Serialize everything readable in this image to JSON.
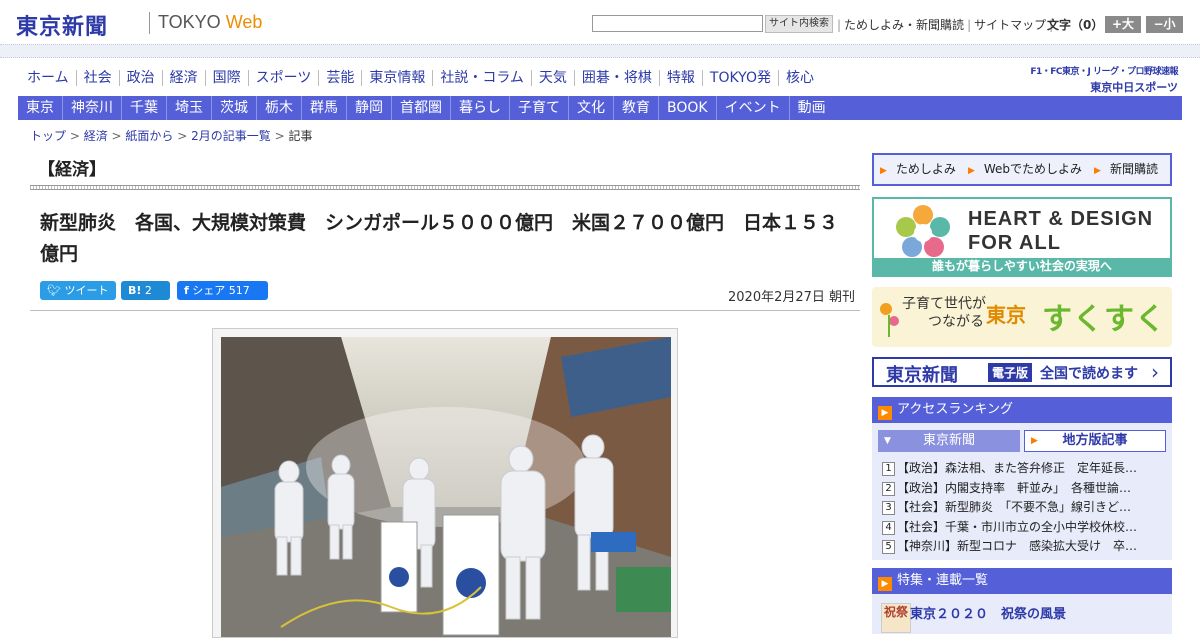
{
  "header": {
    "logo": "東京新聞",
    "tokyo": "TOKYO",
    "web": "Web",
    "search_button": "サイト内検索",
    "links": [
      "ためしよみ・新聞購読",
      "サイトマップ"
    ],
    "font_size_label": "文字（0）",
    "font_bigger": "+大",
    "font_smaller": "−小"
  },
  "nav": {
    "items": [
      "ホーム",
      "社会",
      "政治",
      "経済",
      "国際",
      "スポーツ",
      "芸能",
      "東京情報",
      "社説・コラム",
      "天気",
      "囲碁・将棋",
      "特報",
      "TOKYO発",
      "核心"
    ],
    "sports_line1": "F1・FC東京・J リーグ・プロ野球速報",
    "sports_line2": "東京中日スポーツ"
  },
  "subnav": {
    "items": [
      "東京",
      "神奈川",
      "千葉",
      "埼玉",
      "茨城",
      "栃木",
      "群馬",
      "静岡",
      "首都圏",
      "暮らし",
      "子育て",
      "文化",
      "教育",
      "BOOK",
      "イベント",
      "動画"
    ]
  },
  "breadcrumb": {
    "items": [
      "トップ",
      "経済",
      "紙面から",
      "2月の記事一覧"
    ],
    "current": "記事"
  },
  "article": {
    "category": "【経済】",
    "title": "新型肺炎　各国、大規模対策費　シンガポール５０００億円　米国２７００億円　日本１５３億円",
    "tweet": "ツイート",
    "hatena_label": "B!",
    "hatena_count": "2",
    "fb_label": "シェア",
    "fb_count": "517",
    "date": "2020年2月27日 朝刊"
  },
  "sidebar": {
    "links": [
      "ためしよみ",
      "Webでためしよみ",
      "新聞購読"
    ],
    "hd_line1": "HEART & DESIGN",
    "hd_line2": "FOR ALL",
    "hd_sub": "誰もが暮らしやすい社会の実現へ",
    "ss_small1": "子育て世代が",
    "ss_small2": "つながる",
    "ss_tokyo": "東京",
    "ss_big": "すくすく",
    "ed_logo": "東京新聞",
    "ed_badge": "電子版",
    "ed_text": "全国で読めます",
    "ranking_title": "アクセスランキング",
    "ranking_tab1": "東京新聞",
    "ranking_tab2": "地方版記事",
    "ranking": [
      {
        "num": "1",
        "text": "【政治】森法相、また答弁修正　定年延長…"
      },
      {
        "num": "2",
        "text": "【政治】内閣支持率　軒並み」　各種世論…"
      },
      {
        "num": "3",
        "text": "【社会】新型肺炎　「不要不急」線引きど…"
      },
      {
        "num": "4",
        "text": "【社会】千葉・市川市立の全小中学校休校…"
      },
      {
        "num": "5",
        "text": "【神奈川】新型コロナ　感染拡大受け　卒…"
      }
    ],
    "features_title": "特集・連載一覧",
    "feature_thumb": "祝祭",
    "feature_item": "東京２０２０　祝祭の風景"
  },
  "colors": {
    "brand_blue": "#2d3aa8",
    "nav_bar": "#5560d8",
    "accent_orange": "#ff8a00"
  }
}
